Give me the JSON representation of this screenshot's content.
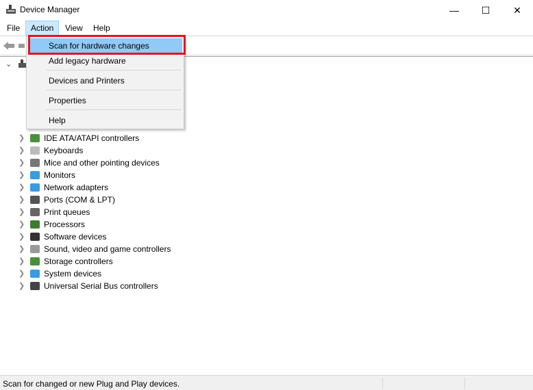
{
  "window": {
    "title": "Device Manager",
    "icon": "device-manager-icon",
    "controls": [
      "minimize",
      "maximize",
      "close"
    ]
  },
  "menubar": {
    "items": [
      "File",
      "Action",
      "View",
      "Help"
    ],
    "active": "Action"
  },
  "toolbar": {
    "buttons": [
      "back-arrow-icon",
      "forward-arrow-icon"
    ]
  },
  "dropdown": {
    "items": [
      {
        "label": "Scan for hardware changes",
        "highlighted": true
      },
      {
        "label": "Add legacy hardware"
      },
      {
        "label": "Devices and Printers"
      },
      {
        "label": "Properties"
      },
      {
        "label": "Help"
      }
    ],
    "highlight_color": "#91c9f7",
    "annotation_color": "#e81123"
  },
  "tree": {
    "items": [
      {
        "label": "IDE ATA/ATAPI controllers",
        "icon": "ide-controller-icon"
      },
      {
        "label": "Keyboards",
        "icon": "keyboard-icon"
      },
      {
        "label": "Mice and other pointing devices",
        "icon": "mouse-icon"
      },
      {
        "label": "Monitors",
        "icon": "monitor-icon"
      },
      {
        "label": "Network adapters",
        "icon": "network-adapter-icon"
      },
      {
        "label": "Ports (COM & LPT)",
        "icon": "port-icon"
      },
      {
        "label": "Print queues",
        "icon": "printer-icon"
      },
      {
        "label": "Processors",
        "icon": "processor-icon"
      },
      {
        "label": "Software devices",
        "icon": "software-device-icon"
      },
      {
        "label": "Sound, video and game controllers",
        "icon": "speaker-icon"
      },
      {
        "label": "Storage controllers",
        "icon": "storage-controller-icon"
      },
      {
        "label": "System devices",
        "icon": "system-device-icon"
      },
      {
        "label": "Universal Serial Bus controllers",
        "icon": "usb-icon"
      }
    ]
  },
  "status": {
    "text": "Scan for changed or new Plug and Play devices."
  }
}
